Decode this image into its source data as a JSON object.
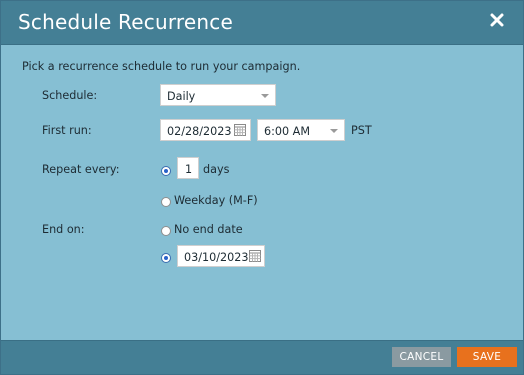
{
  "dialog": {
    "title": "Schedule Recurrence",
    "close_icon": "close-x-icon",
    "intro": "Pick a recurrence schedule to run your campaign."
  },
  "schedule": {
    "label": "Schedule:",
    "value": "Daily"
  },
  "first_run": {
    "label": "First run:",
    "date": "02/28/2023",
    "time": "6:00 AM",
    "timezone": "PST"
  },
  "repeat": {
    "label": "Repeat every:",
    "interval": "1",
    "unit": "days",
    "weekday_option": "Weekday (M-F)",
    "days_selected": true
  },
  "end_on": {
    "label": "End on:",
    "no_end_option": "No end date",
    "end_date": "03/10/2023",
    "end_date_selected": true
  },
  "footer": {
    "cancel_label": "CANCEL",
    "save_label": "SAVE"
  },
  "colors": {
    "titlebar": "#447f95",
    "body": "#86bfd3",
    "save": "#e8711d",
    "cancel": "#8a9aa1"
  }
}
